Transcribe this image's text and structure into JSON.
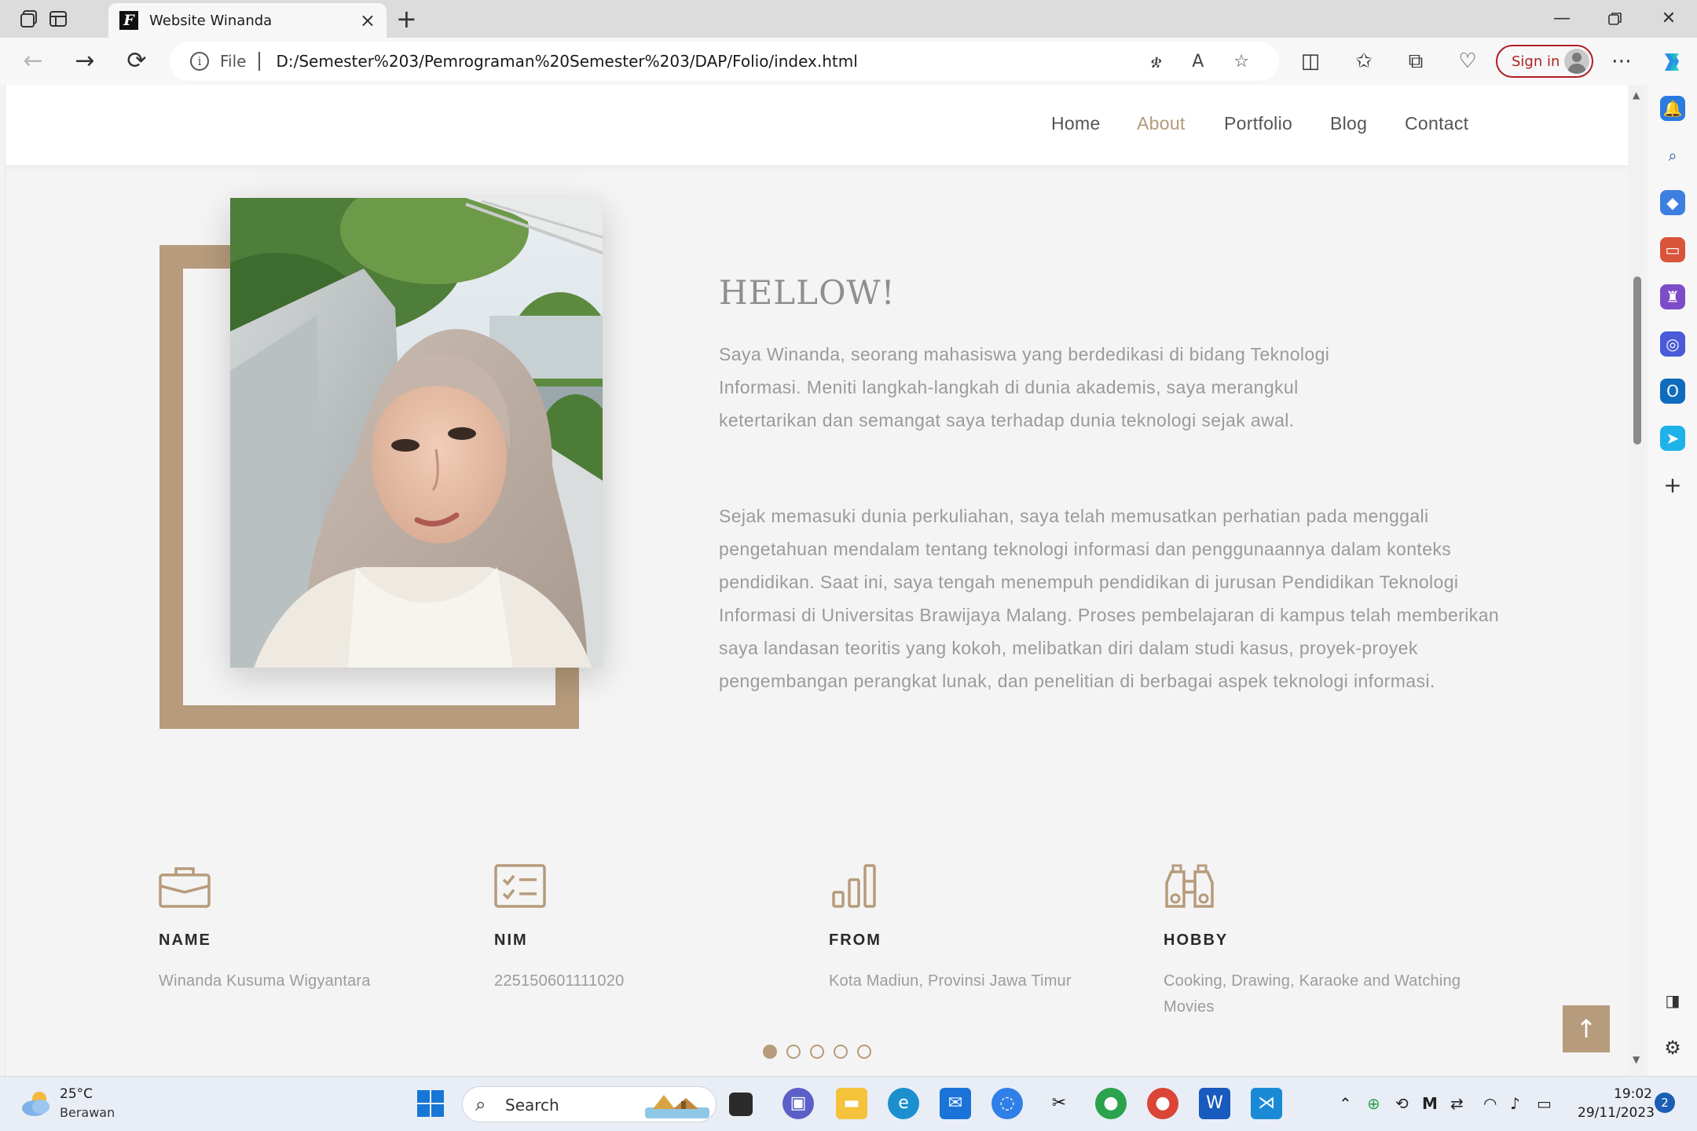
{
  "browser": {
    "tab_title": "Website Winanda",
    "tab_favicon": "F",
    "address_prefix": "File",
    "url": "D:/Semester%203/Pemrograman%20Semester%203/DAP/Folio/index.html",
    "signin_label": "Sign in"
  },
  "site": {
    "nav": [
      "Home",
      "About",
      "Portfolio",
      "Blog",
      "Contact"
    ],
    "active_nav": "About",
    "accent_color": "#b69b7c",
    "heading": "HELLOW!",
    "paragraph1": "Saya Winanda, seorang mahasiswa yang berdedikasi di bidang Teknologi Informasi. Meniti langkah-langkah di dunia akademis, saya merangkul ketertarikan dan semangat saya terhadap dunia teknologi sejak awal.",
    "paragraph2": "Sejak memasuki dunia perkuliahan, saya telah memusatkan perhatian pada menggali pengetahuan mendalam tentang teknologi informasi dan penggunaannya dalam konteks pendidikan. Saat ini, saya tengah menempuh pendidikan di jurusan Pendidikan Teknologi Informasi di Universitas Brawijaya Malang. Proses pembelajaran di kampus telah memberikan saya landasan teoritis yang kokoh, melibatkan diri dalam studi kasus, proyek-proyek pengembangan perangkat lunak, dan penelitian di berbagai aspek teknologi informasi.",
    "info": [
      {
        "label": "NAME",
        "value": "Winanda Kusuma Wigyantara",
        "icon": "briefcase-icon"
      },
      {
        "label": "NIM",
        "value": "225150601111020",
        "icon": "checklist-icon"
      },
      {
        "label": "FROM",
        "value": "Kota Madiun, Provinsi Jawa Timur",
        "icon": "bar-chart-icon"
      },
      {
        "label": "HOBBY",
        "value": "Cooking, Drawing, Karaoke and Watching Movies",
        "icon": "binoculars-icon"
      }
    ],
    "carousel_pages": 5,
    "carousel_active": 1
  },
  "taskbar": {
    "temperature": "25°C",
    "weather": "Berawan",
    "search_placeholder": "Search",
    "time": "19:02",
    "date": "29/11/2023",
    "notification_count": "2"
  }
}
